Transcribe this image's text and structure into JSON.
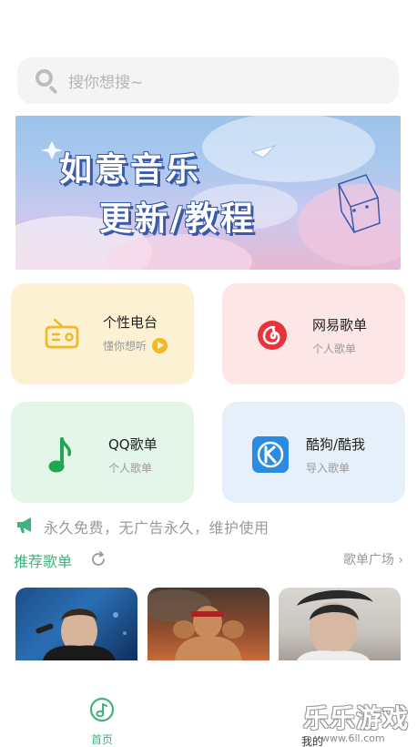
{
  "search": {
    "placeholder": "搜你想搜~"
  },
  "banner": {
    "line1": "如意音乐",
    "line2": "更新/教程"
  },
  "cards": [
    {
      "title": "个性电台",
      "subtitle": "懂你想听",
      "icon": "radio-icon",
      "color": "#f2b826"
    },
    {
      "title": "网易歌单",
      "subtitle": "个人歌单",
      "icon": "netease-music-icon",
      "color": "#e8333a"
    },
    {
      "title": "QQ歌单",
      "subtitle": "个人歌单",
      "icon": "music-note-icon",
      "color": "#21a84f"
    },
    {
      "title": "酷狗/酷我",
      "subtitle": "导入歌单",
      "icon": "kugou-icon",
      "color": "#2a8be0"
    }
  ],
  "notice": {
    "text": "永久免费，无广告永久，维护使用"
  },
  "recommend": {
    "title": "推荐歌单",
    "more": "歌单广场 ›"
  },
  "tabbar": {
    "home": "首页",
    "mine": "我的"
  },
  "watermark": {
    "text": "乐乐游戏",
    "url": "www.6ll.com"
  },
  "colors": {
    "accent": "#3fb37a"
  }
}
